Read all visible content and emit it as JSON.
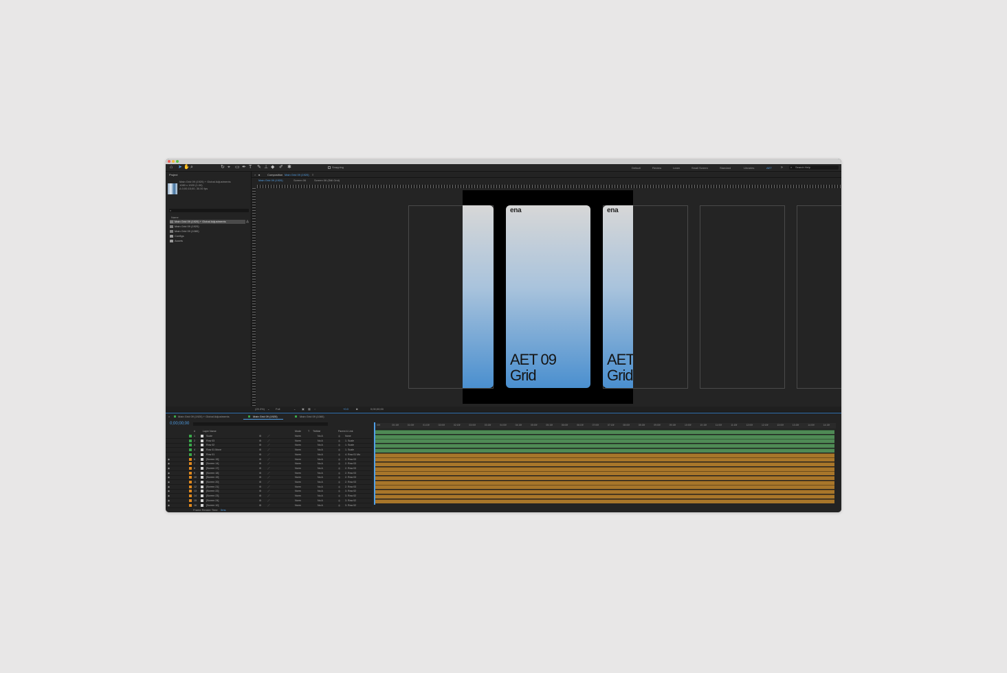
{
  "toolbar": {
    "snapping_label": "Snapping",
    "workspaces": [
      "Default",
      "Review",
      "Learn",
      "Small Screen",
      "Standard",
      "Libraries",
      "AET"
    ],
    "active_workspace": "AET",
    "search_placeholder": "Search Help"
  },
  "project": {
    "panel_title": "Project",
    "selected_name": "Main Grid 09 (1920) + Global Adjustments",
    "selected_size": "1080 x 1920 (1.00)",
    "selected_duration": "Δ 0;00;15;00, 30.00 fps",
    "name_header": "Name",
    "items": [
      {
        "label": "Main Grid 09 (1920) + Global Adjustments",
        "type": "comp",
        "selected": true
      },
      {
        "label": "Main Grid 09 (1920)",
        "type": "comp",
        "selected": false
      },
      {
        "label": "Main Grid 09 (1080)",
        "type": "comp",
        "selected": false
      },
      {
        "label": "Configs",
        "type": "folder",
        "selected": false
      },
      {
        "label": "Assets",
        "type": "folder",
        "selected": false
      }
    ],
    "bpc": "8 bpc"
  },
  "viewer": {
    "panel_title": "Composition",
    "comp_name": "Main Grid 09 (1920)",
    "subtabs": [
      "Main Grid 09 (1920)",
      "Screen 06",
      "Screen 06 (Still Grid)"
    ],
    "zoom": "(29.3%)",
    "resolution": "Full",
    "timecode": "0;00;00;00",
    "exposure": "+0.0"
  },
  "cards": [
    {
      "logo": "ena",
      "line1": "AET 09",
      "line2": "Grid"
    },
    {
      "logo": "ena",
      "line1": "AET",
      "line2": "Grid"
    }
  ],
  "timeline": {
    "tabs": [
      "Main Grid 09 (1920) + Global Adjustments",
      "Main Grid 09 (1920)",
      "Main Grid 09 (1080)"
    ],
    "active_tab": "Main Grid 09 (1920)",
    "timecode": "0;00;00;00",
    "columns": {
      "num": "#",
      "layer_name": "Layer Name",
      "mode": "Mode",
      "t": "T",
      "trkmat": "TrkMat",
      "parent": "Parent & Link"
    },
    "footer": "Frame Render Time",
    "footer_value": "0ms",
    "ticks": [
      "00f",
      "00:15f",
      "01:00f",
      "01:15f",
      "02:00f",
      "02:15f",
      "03:00f",
      "03:15f",
      "04:00f",
      "04:15f",
      "05:00f",
      "05:15f",
      "06:00f",
      "06:15f",
      "07:00f",
      "07:15f",
      "08:00f",
      "08:15f",
      "09:00f",
      "09:15f",
      "10:00f",
      "10:15f",
      "11:00f",
      "11:15f",
      "12:00f",
      "12:15f",
      "13:00f",
      "13:15f",
      "14:00f",
      "14:15f"
    ],
    "layers": [
      {
        "num": "1",
        "name": "Scale",
        "mode": "Norm",
        "trkmat": "No A",
        "parent": "None",
        "color": "green"
      },
      {
        "num": "2",
        "name": "Row 03",
        "mode": "Norm",
        "trkmat": "No A",
        "parent": "1. Scale",
        "color": "green"
      },
      {
        "num": "3",
        "name": "Row 02",
        "mode": "Norm",
        "trkmat": "No A",
        "parent": "1. Scale",
        "color": "green"
      },
      {
        "num": "4",
        "name": "Row 01 Move",
        "mode": "Norm",
        "trkmat": "No A",
        "parent": "1. Scale",
        "color": "green"
      },
      {
        "num": "5",
        "name": "Row 01",
        "mode": "Norm",
        "trkmat": "No A",
        "parent": "4. Row 01 Mo",
        "color": "green"
      },
      {
        "num": "6",
        "name": "[Screen 15]",
        "mode": "Norm",
        "trkmat": "No A",
        "parent": "2. Row 03",
        "color": "orange"
      },
      {
        "num": "7",
        "name": "[Screen 14]",
        "mode": "Norm",
        "trkmat": "No A",
        "parent": "2. Row 03",
        "color": "orange"
      },
      {
        "num": "8",
        "name": "[Screen 17]",
        "mode": "Norm",
        "trkmat": "No A",
        "parent": "2. Row 03",
        "color": "orange"
      },
      {
        "num": "9",
        "name": "[Screen 18]",
        "mode": "Norm",
        "trkmat": "No A",
        "parent": "2. Row 03",
        "color": "orange"
      },
      {
        "num": "10",
        "name": "[Screen 19]",
        "mode": "Norm",
        "trkmat": "No A",
        "parent": "2. Row 03",
        "color": "orange"
      },
      {
        "num": "11",
        "name": "[Screen 20]",
        "mode": "Norm",
        "trkmat": "No A",
        "parent": "2. Row 03",
        "color": "orange"
      },
      {
        "num": "12",
        "name": "[Screen 21]",
        "mode": "Norm",
        "trkmat": "No A",
        "parent": "2. Row 03",
        "color": "orange"
      },
      {
        "num": "13",
        "name": "[Screen 22]",
        "mode": "Norm",
        "trkmat": "No A",
        "parent": "3. Row 02",
        "color": "orange"
      },
      {
        "num": "14",
        "name": "[Screen 23]",
        "mode": "Norm",
        "trkmat": "No A",
        "parent": "3. Row 02",
        "color": "orange"
      },
      {
        "num": "15",
        "name": "[Screen 24]",
        "mode": "Norm",
        "trkmat": "No A",
        "parent": "3. Row 02",
        "color": "orange"
      },
      {
        "num": "16",
        "name": "[Screen 10]",
        "mode": "Norm",
        "trkmat": "No A",
        "parent": "3. Row 02",
        "color": "orange"
      }
    ]
  },
  "colors": {
    "accent": "#4f9fe8",
    "label_green": "#3aa84a",
    "label_orange": "#e0891e",
    "bar_green": "#4f8a55",
    "bar_orange": "#a8762a"
  }
}
